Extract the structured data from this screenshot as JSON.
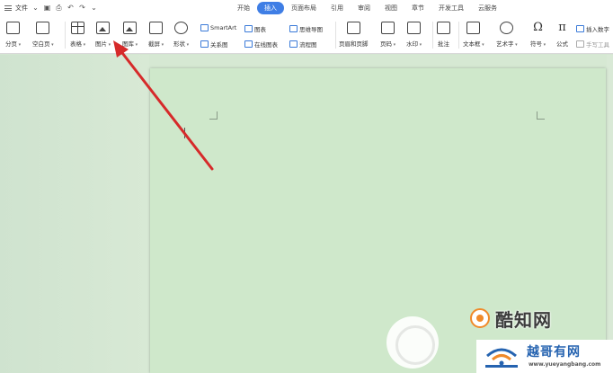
{
  "menubar": {
    "file_label": "文件",
    "tabs": [
      {
        "label": "开始",
        "active": false
      },
      {
        "label": "插入",
        "active": true
      },
      {
        "label": "页面布局",
        "active": false
      },
      {
        "label": "引用",
        "active": false
      },
      {
        "label": "审阅",
        "active": false
      },
      {
        "label": "视图",
        "active": false
      },
      {
        "label": "章节",
        "active": false
      },
      {
        "label": "开发工具",
        "active": false
      },
      {
        "label": "云服务",
        "active": false
      }
    ]
  },
  "ribbon": {
    "page_break": "分页",
    "blank_page": "空白页",
    "table": "表格",
    "picture": "图片",
    "gallery": "图库",
    "screenshot": "截屏",
    "shapes": "形状",
    "smartart": "SmartArt",
    "relation_chart": "关系图",
    "chart": "图表",
    "online_chart": "在线图表",
    "mind_map": "思维导图",
    "flowchart": "流程图",
    "header_footer": "页眉和页脚",
    "page_number": "页码",
    "watermark": "水印",
    "comment": "批注",
    "textbox": "文本框",
    "wordart": "艺术字",
    "symbol": "符号",
    "formula": "公式",
    "insert_number": "插入数字",
    "handwriting": "手写工具"
  },
  "watermarks": {
    "kuzhi_text": "酷知网",
    "yue_title": "越哥有网",
    "yue_url": "www.yueyangbang.com"
  },
  "colors": {
    "active_tab": "#3f7ee5",
    "page_background": "#cfe8cb",
    "arrow": "#d62a2a"
  }
}
